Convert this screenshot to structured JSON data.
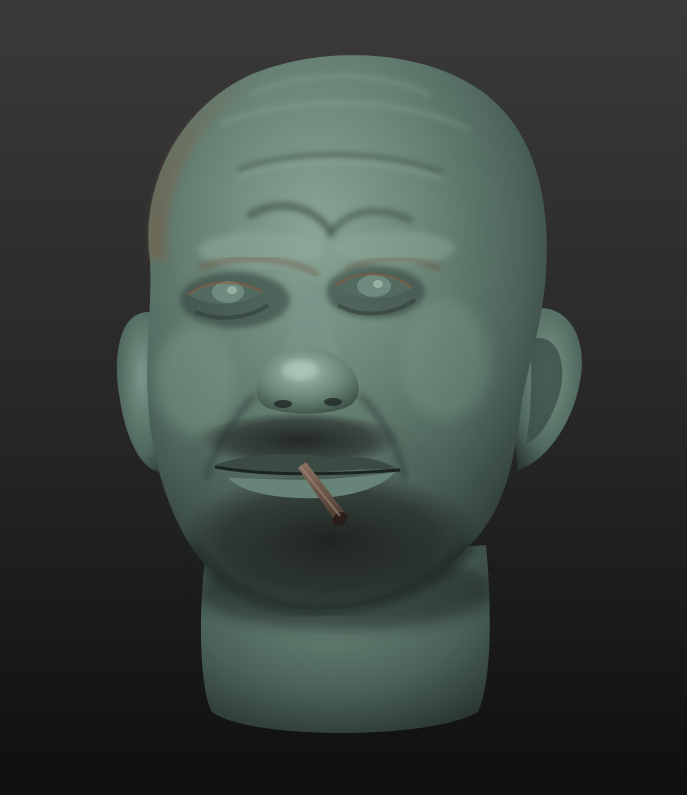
{
  "scene": {
    "subject": "sculpted-head",
    "material": "matcap-clay",
    "colors": {
      "background_top": "#3a3a3a",
      "background_bottom": "#0f0f0f",
      "skin_light": "#7f9b8e",
      "skin_mid": "#587064",
      "skin_dark": "#24302c",
      "rim_warm": "#8a5a3e",
      "stubble": "#1a1c1a",
      "cigarette": "#6b5548",
      "cigarette_tip": "#2a1e1a"
    }
  }
}
